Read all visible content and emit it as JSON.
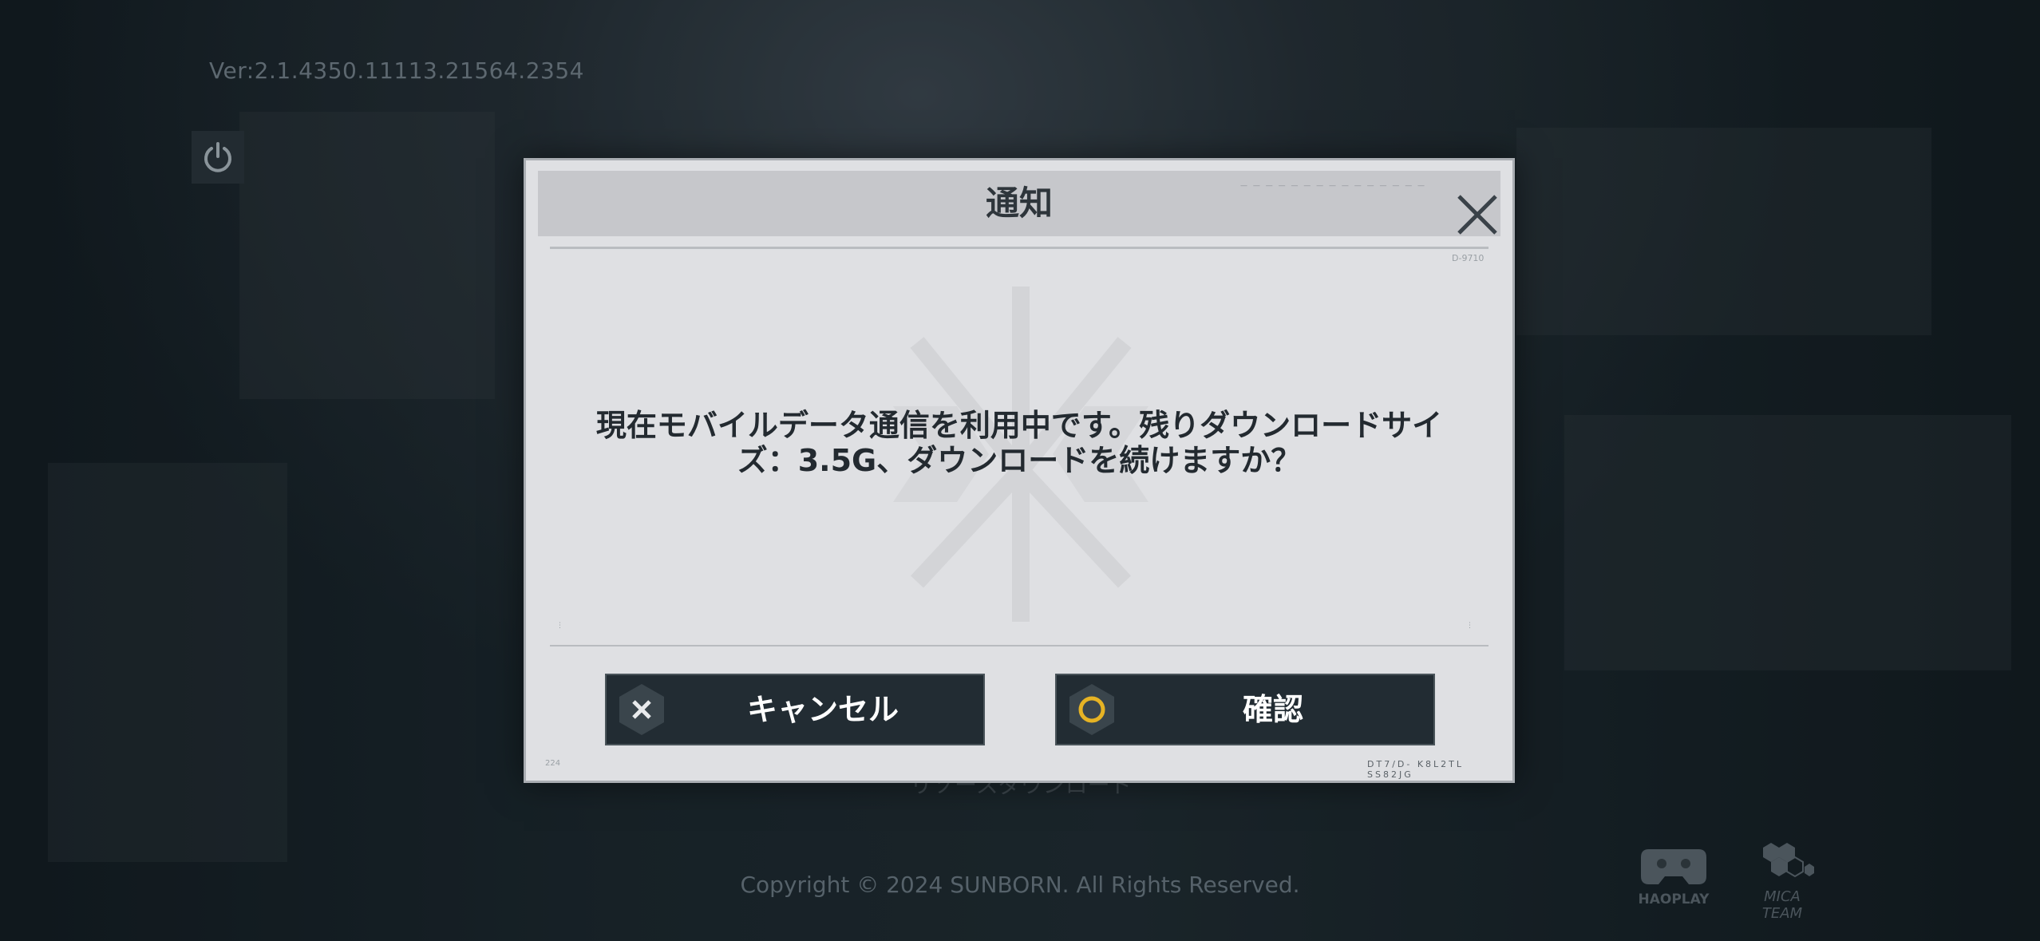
{
  "app": {
    "version": "Ver:2.1.4350.11113.21564.2354",
    "background_behind_text": "リソースダウンロード",
    "copyright": "Copyright © 2024 SUNBORN. All Rights Reserved.",
    "logos": [
      {
        "icon": "gamepad-icon",
        "label": "HAOPLAY"
      },
      {
        "icon": "hexagon-cluster-icon",
        "label": "MICA TEAM"
      }
    ]
  },
  "dialog": {
    "title": "通知",
    "serial_top_right": "D-9710",
    "message_line1": "現在モバイルデータ通信を利用中です。残りダウンロードサイ",
    "message_line2": "ズ：3.5G、ダウンロードを続けますか？",
    "cancel_label": "キャンセル",
    "confirm_label": "確認",
    "footer_code": "DT7/D- K8L2TL SS82JG",
    "footer_left": "224",
    "colors": {
      "confirm_ring": "#e6b324",
      "button_bg": "#222c33",
      "panel_bg": "#dfe0e3"
    }
  }
}
